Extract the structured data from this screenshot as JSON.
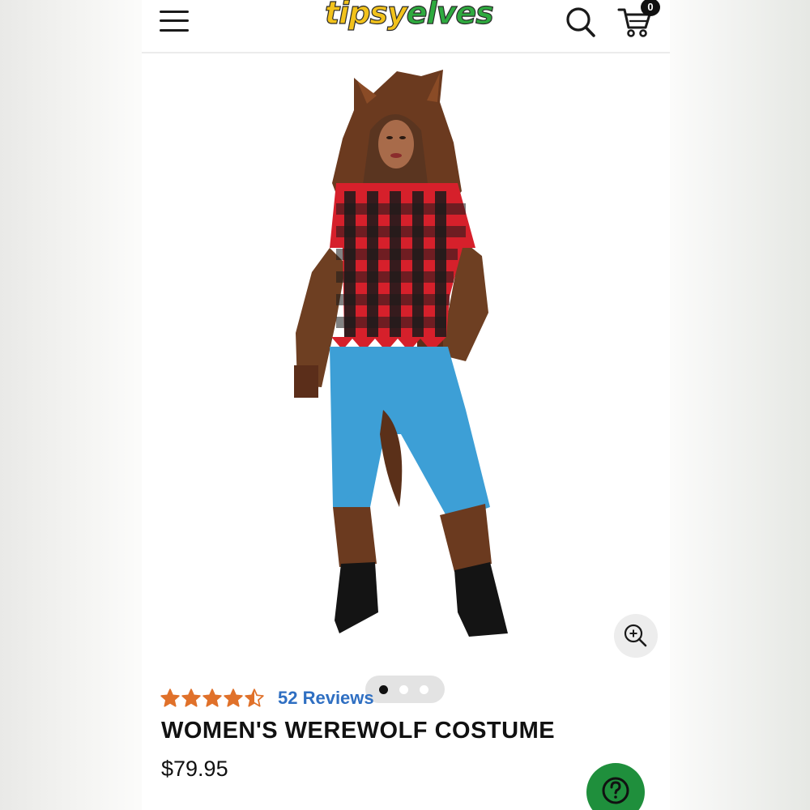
{
  "header": {
    "logo_part1": "tipsy",
    "logo_part2": "elves",
    "cart_count": "0",
    "icons": [
      "hamburger-menu-icon",
      "search-icon",
      "cart-icon"
    ]
  },
  "gallery": {
    "dots": 3,
    "active_dot": 0,
    "zoom_icon": "zoom-in-icon"
  },
  "product": {
    "rating": 4.5,
    "rating_max": 5,
    "reviews_label": "52 Reviews",
    "title": "WOMEN'S WEREWOLF COSTUME",
    "price": "$79.95"
  },
  "help": {
    "icon": "question-mark-icon"
  },
  "colors": {
    "star": "#e0712a",
    "reviews_link": "#2f6fc2",
    "help_button": "#1f8f3c",
    "logo_yellow": "#f2c21b",
    "logo_green": "#2eaa3f"
  }
}
